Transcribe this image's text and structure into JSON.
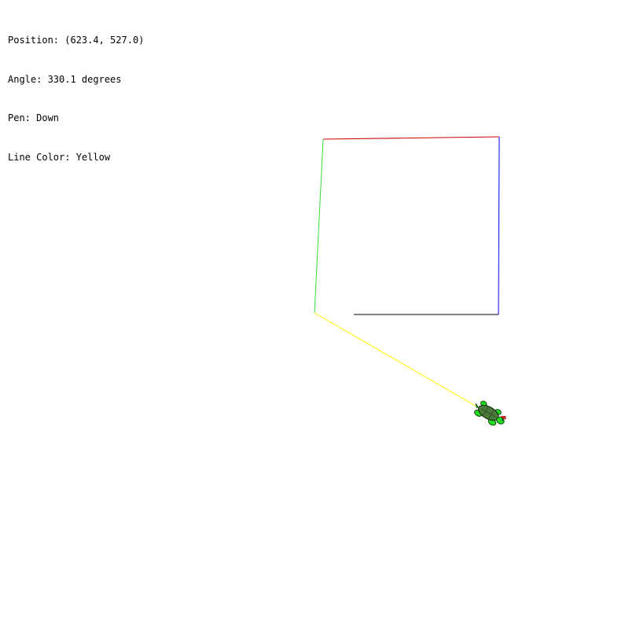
{
  "status": {
    "position_line": "Position: (623.4, 527.0)",
    "angle_line": "Angle: 330.1 degrees",
    "pen_line": "Pen: Down",
    "color_line": "Line Color: Yellow"
  },
  "turtle": {
    "icon": "turtle-icon",
    "heading_degrees": 330.1
  },
  "trail_colors": {
    "black": "#000000",
    "blue": "#0000ff",
    "red": "#cc0000",
    "green": "#33dd33",
    "yellow": "#ffff00"
  }
}
